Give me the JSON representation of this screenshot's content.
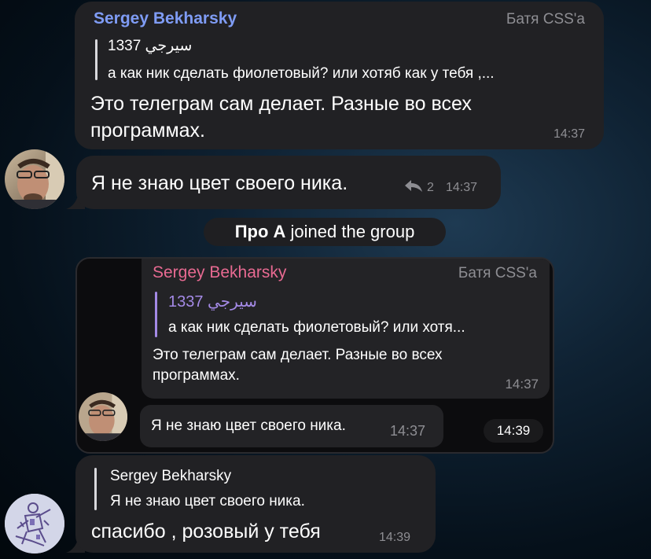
{
  "messages": [
    {
      "sender": "Sergey Bekharsky",
      "role": "Батя CSS'a",
      "quote_title": "سيرجي 1337",
      "quote_text": "а как ник сделать фиолетовый? или хотяб как у тебя ,...",
      "text": "Это телеграм сам делает. Разные во всех программах.",
      "time": "14:37"
    },
    {
      "text": "Я не знаю цвет своего ника.",
      "replies_count": "2",
      "time": "14:37"
    },
    {
      "service_name": "Про А",
      "service_action": "joined the group"
    },
    {
      "forward_sender": "Sergey Bekharsky",
      "forward_role": "Батя CSS'a",
      "forward_quote_title": "سيرجي 1337",
      "forward_quote_text": "а как ник сделать фиолетовый? или хотя...",
      "forward_text": "Это телеграм сам делает. Разные во всех программах.",
      "forward_time": "14:37",
      "forward_msg2": "Я не знаю цвет своего ника.",
      "forward_msg2_time": "14:37",
      "screenshot_time": "14:39"
    },
    {
      "quote_title": "Sergey Bekharsky",
      "quote_text": "Я не знаю цвет своего ника.",
      "text": "спасибо , розовый у тебя",
      "time": "14:39"
    }
  ],
  "colors": {
    "sergey_blue": "#7f9cf5",
    "sergey_pink": "#e86a92",
    "quote_purple": "#a48ae6"
  }
}
